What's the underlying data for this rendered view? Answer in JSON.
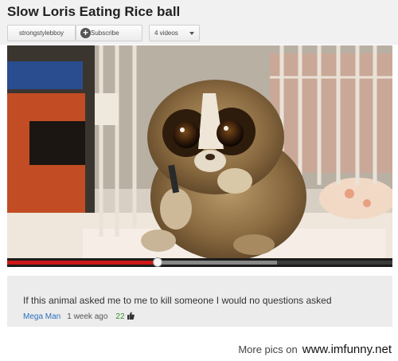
{
  "video": {
    "title": "Slow Loris Eating Rice ball",
    "channel": "strongstylebboy",
    "subscribe_label": "Subscribe",
    "videos_label": "4 videos",
    "icons": {
      "subscribe": "plus-circle-icon",
      "videos": "chevron-down-icon"
    },
    "progress": {
      "played_fraction": 0.39,
      "buffered_fraction": 0.7
    },
    "colors": {
      "progress_played": "#cc1818",
      "header_bg": "#f1f1f1"
    }
  },
  "comment": {
    "text": "If this animal asked me to me to kill someone I would no questions asked",
    "author": "Mega Man",
    "time": "1 week ago",
    "likes": "22",
    "icons": {
      "like": "thumbs-up-icon"
    },
    "colors": {
      "author": "#2a6fc0",
      "likes": "#3a8f2c",
      "bg": "#ececec"
    }
  },
  "footer": {
    "prefix": "More pics on",
    "site": "www.imfunny.net"
  }
}
